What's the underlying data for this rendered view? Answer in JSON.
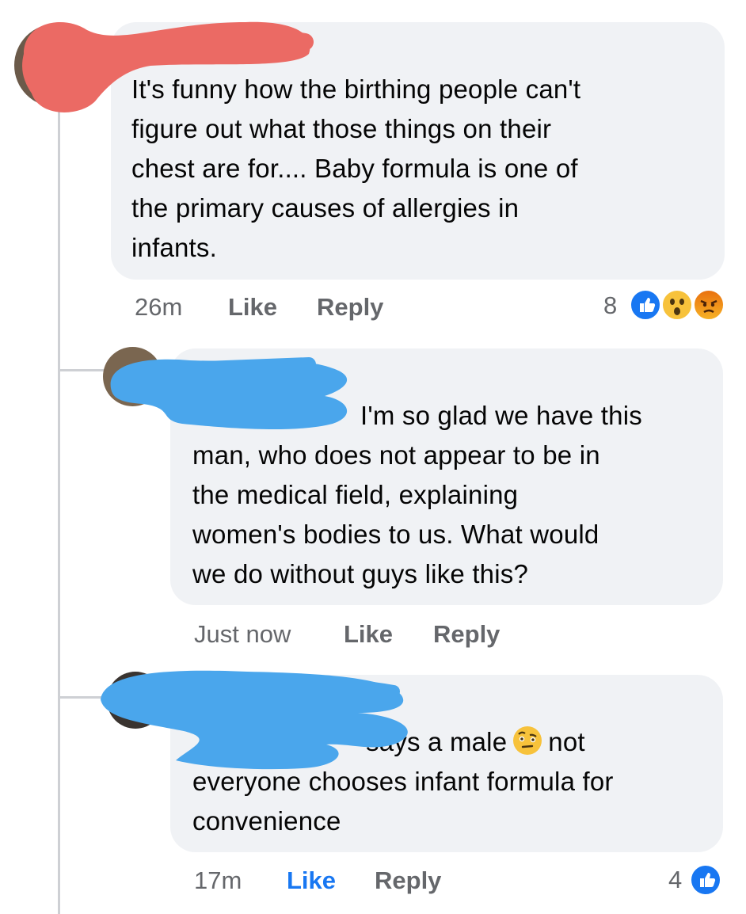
{
  "comments": [
    {
      "text": "It's funny how the birthing people can't figure out what those things on their chest are for.... Baby formula is one of the primary causes of allergies in infants.",
      "lines": [
        "It's funny how the birthing people can't",
        "figure out what those things on their",
        "chest are for.... Baby formula is one of",
        "the primary causes of allergies in",
        "infants."
      ],
      "time": "26m",
      "like_label": "Like",
      "reply_label": "Reply",
      "reaction_count": "8",
      "reactions": [
        "like-icon",
        "wow-icon",
        "angry-icon"
      ]
    },
    {
      "lines": [
        "I'm so glad we have this",
        "man, who does not appear to be in",
        "the medical field, explaining",
        "women's bodies to us. What would",
        "we do without guys like this?"
      ],
      "time": "Just now",
      "like_label": "Like",
      "reply_label": "Reply"
    },
    {
      "line1_a": "says a male",
      "line1_b": "not",
      "lines": [
        "everyone chooses infant formula for",
        "convenience"
      ],
      "inline_emoji": "raised-eyebrow-emoji",
      "time": "17m",
      "like_label": "Like",
      "like_active": true,
      "reply_label": "Reply",
      "reaction_count": "4",
      "reactions": [
        "like-icon"
      ]
    }
  ],
  "colors": {
    "bubble": "#f0f2f5",
    "text": "#050505",
    "meta": "#65676b",
    "link_blue": "#1877f2",
    "red_redaction": "#eb6a64",
    "blue_redaction": "#4aa6ec"
  }
}
